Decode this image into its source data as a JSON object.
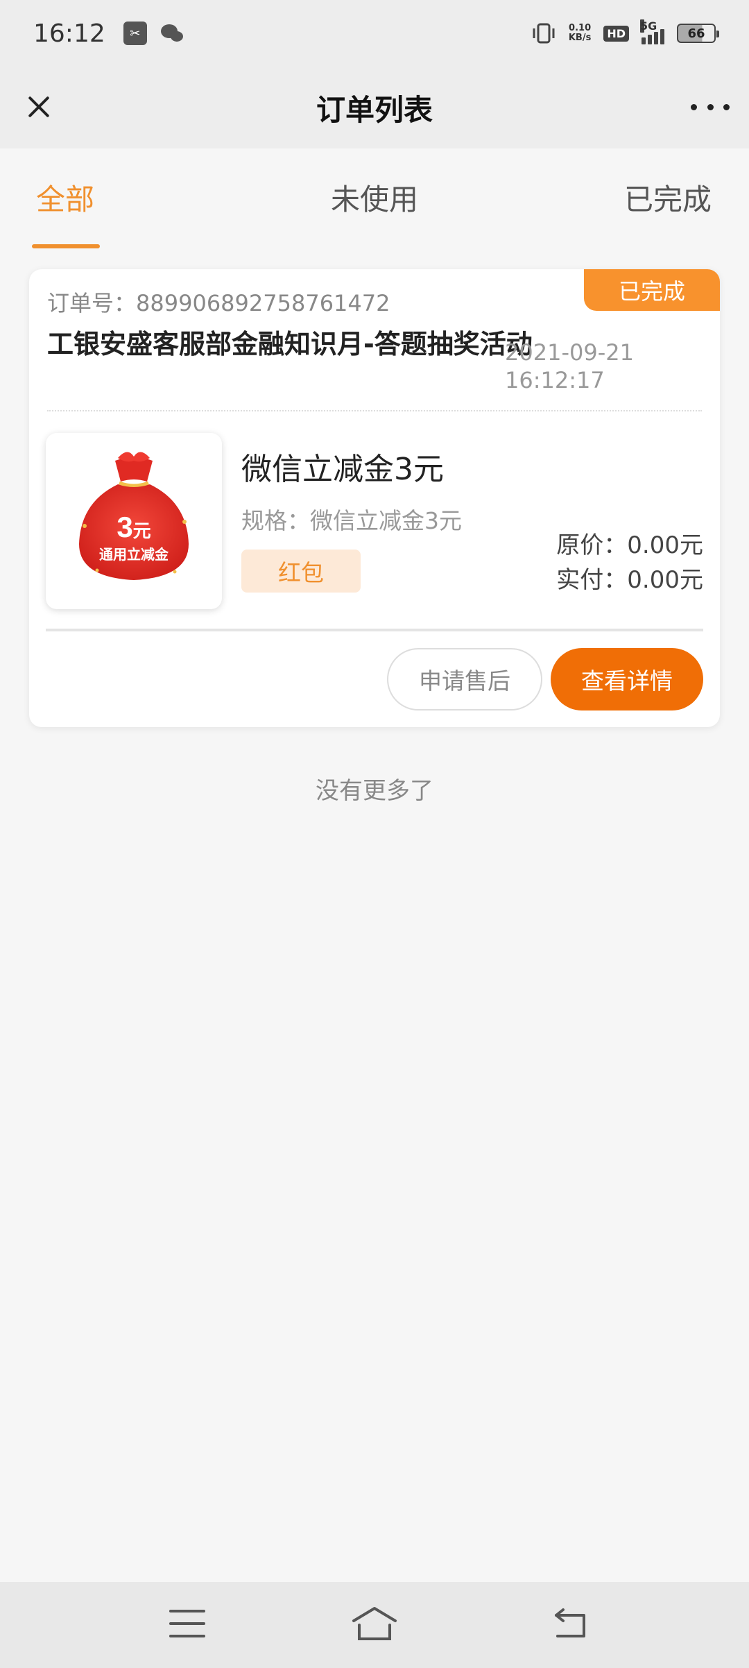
{
  "status_bar": {
    "time": "16:12",
    "net_speed_value": "0.10",
    "net_speed_unit": "KB/s",
    "hd": "HD",
    "network": "5G",
    "battery": "66"
  },
  "nav": {
    "title": "订单列表"
  },
  "tabs": [
    {
      "label": "全部",
      "active": true
    },
    {
      "label": "未使用",
      "active": false
    },
    {
      "label": "已完成",
      "active": false
    }
  ],
  "order": {
    "status": "已完成",
    "order_no_label": "订单号：",
    "order_no": "889906892758761472",
    "title": "工银安盛客服部金融知识月-答题抽奖活动",
    "date": "2021-09-21",
    "time": "16:12:17",
    "thumb_amount": "3",
    "thumb_unit": "元",
    "thumb_caption": "通用立减金",
    "product_name": "微信立减金3元",
    "spec": "规格：微信立减金3元",
    "tag": "红包",
    "price_original": "原价：0.00元",
    "price_paid": "实付：0.00元",
    "btn_aftersale": "申请售后",
    "btn_detail": "查看详情"
  },
  "footer_text": "没有更多了",
  "colors": {
    "accent": "#f0902e",
    "status_tag": "#f8922d",
    "primary_button": "#f06e06",
    "pouch_red": "#e8322b"
  }
}
